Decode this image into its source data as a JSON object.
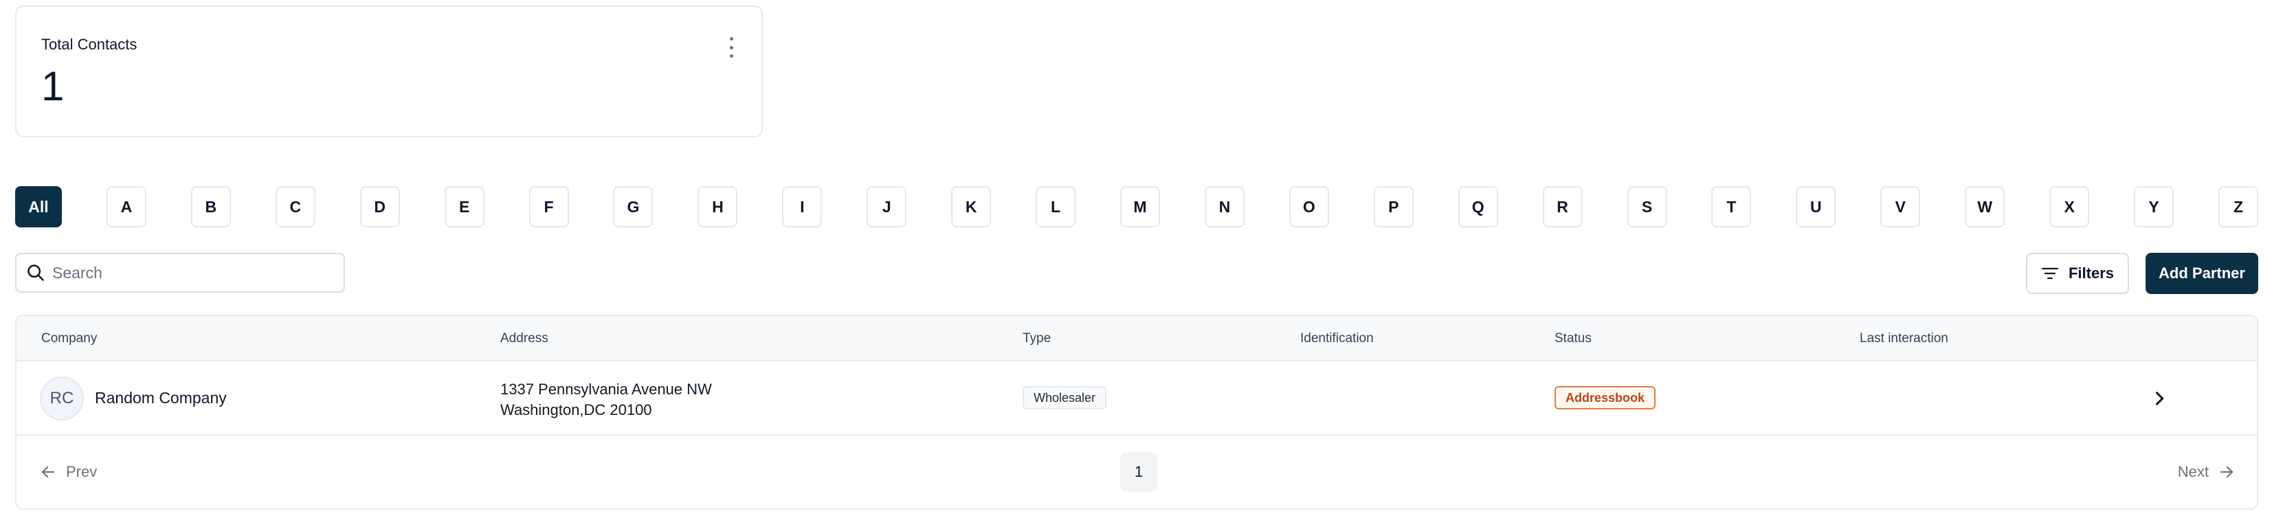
{
  "stat_card": {
    "title": "Total Contacts",
    "value": "1"
  },
  "letters": [
    "All",
    "A",
    "B",
    "C",
    "D",
    "E",
    "F",
    "G",
    "H",
    "I",
    "J",
    "K",
    "L",
    "M",
    "N",
    "O",
    "P",
    "Q",
    "R",
    "S",
    "T",
    "U",
    "V",
    "W",
    "X",
    "Y",
    "Z"
  ],
  "active_letter": "All",
  "search": {
    "placeholder": "Search",
    "value": ""
  },
  "toolbar": {
    "filters_label": "Filters",
    "add_label": "Add Partner"
  },
  "table": {
    "headers": {
      "company": "Company",
      "address": "Address",
      "type": "Type",
      "identification": "Identification",
      "status": "Status",
      "last_interaction": "Last interaction"
    },
    "rows": [
      {
        "initials": "RC",
        "company": "Random Company",
        "address_line1": "1337 Pennsylvania Avenue NW",
        "address_line2": "Washington,DC 20100",
        "type": "Wholesaler",
        "identification": "",
        "status": "Addressbook",
        "last_interaction": ""
      }
    ]
  },
  "pagination": {
    "prev_label": "Prev",
    "next_label": "Next",
    "current_page": "1"
  },
  "colors": {
    "primary": "#0b3045",
    "status_border": "#ea7b3c",
    "status_text": "#b5471a",
    "border": "#e7e9ee"
  }
}
